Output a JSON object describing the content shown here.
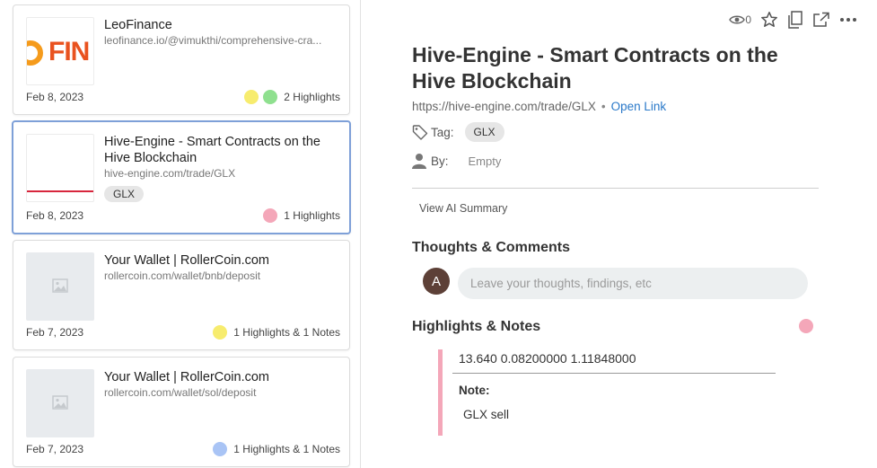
{
  "cards": [
    {
      "title": "LeoFinance",
      "url": "leofinance.io/@vimukthi/comprehensive-cra...",
      "thumb_text": "FIN",
      "date": "Feb 8, 2023",
      "dots": [
        "#f7ec6e",
        "#8fe08f"
      ],
      "meta": "2 Highlights"
    },
    {
      "title": "Hive-Engine - Smart Contracts on the Hive Blockchain",
      "url": "hive-engine.com/trade/GLX",
      "tag": "GLX",
      "date": "Feb 8, 2023",
      "dots": [
        "#f4a7b9"
      ],
      "meta": "1 Highlights"
    },
    {
      "title": "Your Wallet | RollerCoin.com",
      "url": "rollercoin.com/wallet/bnb/deposit",
      "date": "Feb 7, 2023",
      "dots": [
        "#f7ec6e"
      ],
      "meta": "1 Highlights & 1 Notes"
    },
    {
      "title": "Your Wallet | RollerCoin.com",
      "url": "rollercoin.com/wallet/sol/deposit",
      "date": "Feb 7, 2023",
      "dots": [
        "#a9c4f5"
      ],
      "meta": "1 Highlights & 1 Notes"
    }
  ],
  "detail": {
    "views": "0",
    "title": "Hive-Engine - Smart Contracts on the Hive Blockchain",
    "url": "https://hive-engine.com/trade/GLX",
    "separator": "•",
    "open_link": "Open Link",
    "tag_label": "Tag:",
    "tag": "GLX",
    "by_label": "By:",
    "by_value": "Empty",
    "ai_summary": "View AI Summary",
    "comments_title": "Thoughts & Comments",
    "avatar_letter": "A",
    "comment_placeholder": "Leave your thoughts, findings, etc",
    "highlights_title": "Highlights & Notes",
    "highlight_color": "#f4a7b9",
    "highlight_text": "13.640 0.08200000 1.11848000",
    "note_label": "Note:",
    "note_text": "GLX sell"
  }
}
